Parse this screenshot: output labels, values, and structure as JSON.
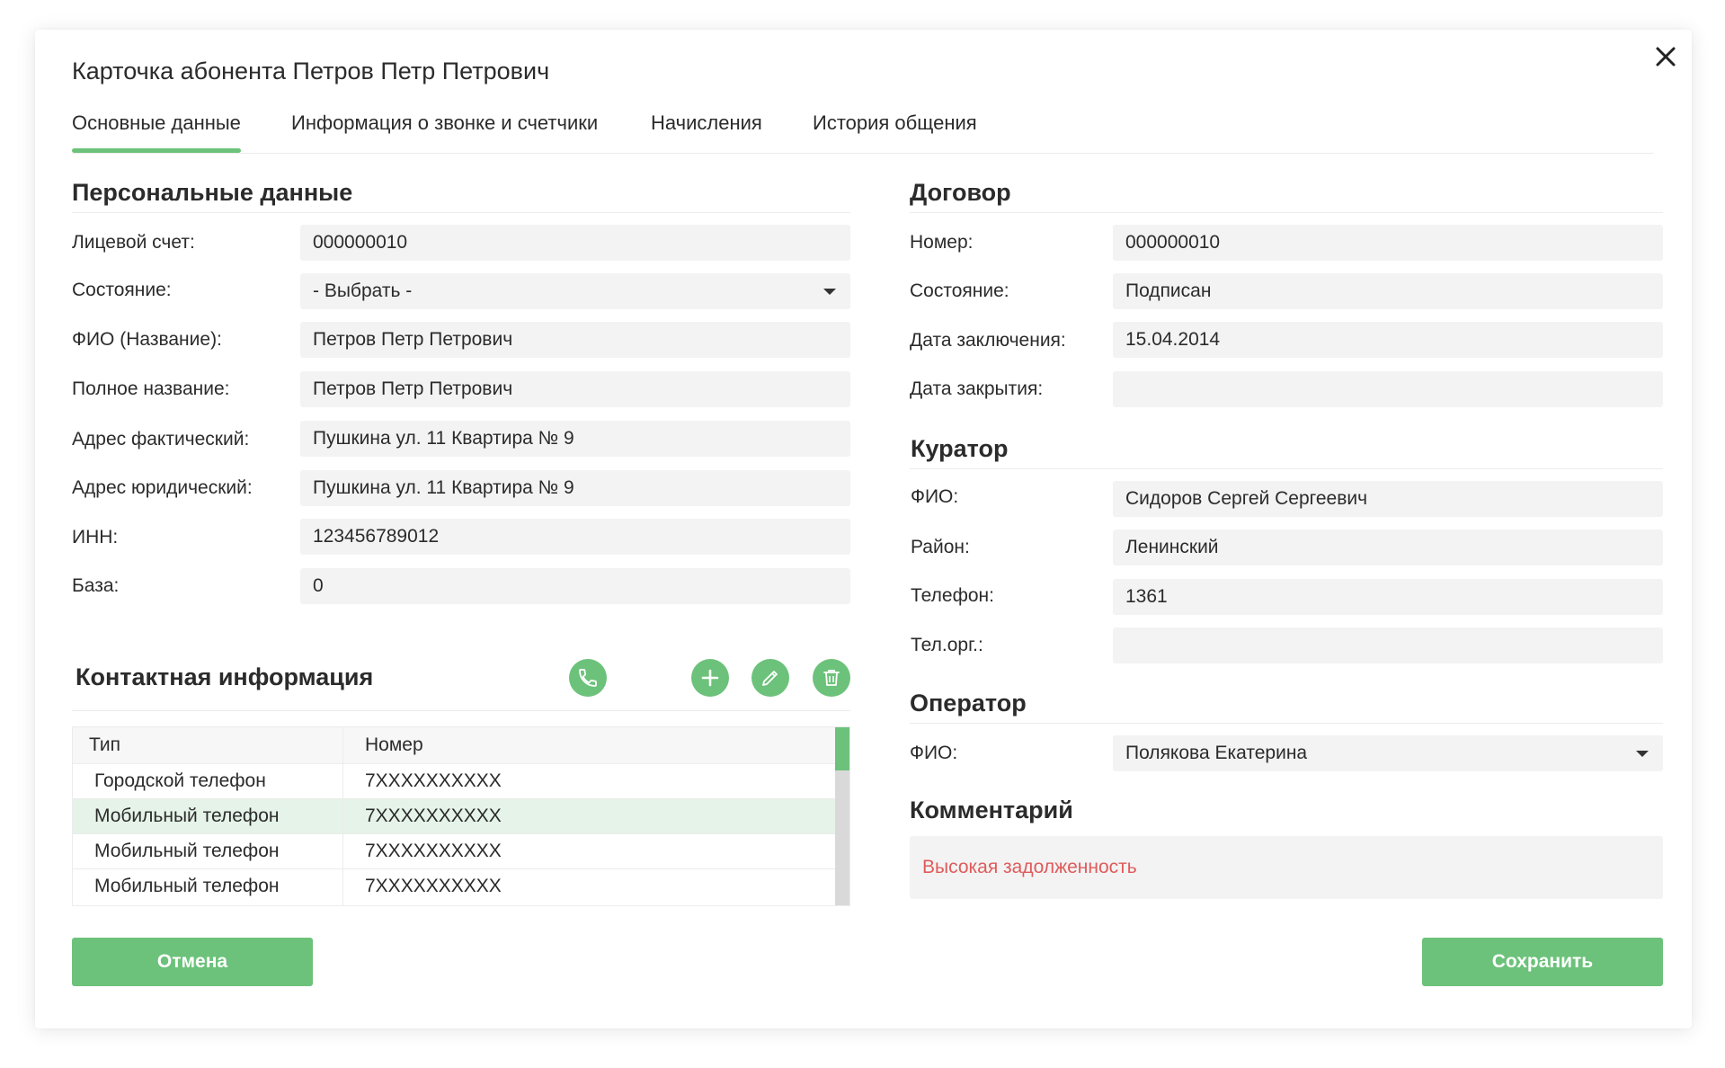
{
  "title": "Карточка абонента Петров Петр Петрович",
  "tabs": [
    {
      "label": "Основные данные",
      "active": true
    },
    {
      "label": "Информация о звонке и счетчики",
      "active": false
    },
    {
      "label": "Начисления",
      "active": false
    },
    {
      "label": "История общения",
      "active": false
    }
  ],
  "personal": {
    "heading": "Персональные данные",
    "fields": [
      {
        "label": "Лицевой счет:",
        "value": "000000010"
      },
      {
        "label": "Состояние:",
        "value": "- Выбрать -"
      },
      {
        "label": "ФИО (Название):",
        "value": "Петров Петр Петрович"
      },
      {
        "label": "Полное название:",
        "value": "Петров Петр Петрович"
      },
      {
        "label": "Адрес фактический:",
        "value": "Пушкина ул. 11 Квартира № 9"
      },
      {
        "label": "Адрес юридический:",
        "value": "Пушкина ул. 11 Квартира № 9"
      },
      {
        "label": "ИНН:",
        "value": "123456789012"
      },
      {
        "label": "База:",
        "value": "0"
      }
    ]
  },
  "contacts": {
    "heading": "Контактная информация",
    "columns": [
      "Тип",
      "Номер"
    ],
    "rows": [
      {
        "type": "Городской телефон",
        "number": "7XXXXXXXXXX"
      },
      {
        "type": "Мобильный телефон",
        "number": "7XXXXXXXXXX"
      },
      {
        "type": "Мобильный телефон",
        "number": "7XXXXXXXXXX"
      },
      {
        "type": "Мобильный телефон",
        "number": "7XXXXXXXXXX"
      }
    ],
    "selected_row": 1
  },
  "contract": {
    "heading": "Договор",
    "fields": [
      {
        "label": "Номер:",
        "value": "000000010"
      },
      {
        "label": "Состояние:",
        "value": "Подписан"
      },
      {
        "label": "Дата заключения:",
        "value": "15.04.2014"
      },
      {
        "label": "Дата закрытия:",
        "value": ""
      }
    ]
  },
  "curator": {
    "heading": "Куратор",
    "fields": [
      {
        "label": "ФИО:",
        "value": "Сидоров Сергей Сергеевич"
      },
      {
        "label": "Район:",
        "value": "Ленинский"
      },
      {
        "label": "Телефон:",
        "value": "1361"
      },
      {
        "label": "Тел.орг.:",
        "value": ""
      }
    ]
  },
  "operator": {
    "heading": "Оператор",
    "fields": [
      {
        "label": "ФИО:",
        "value": "Полякова Екатерина"
      }
    ]
  },
  "comment": {
    "heading": "Комментарий",
    "value": "Высокая задолженность",
    "color": "#e05b5b"
  },
  "buttons": {
    "cancel": "Отмена",
    "save": "Сохранить"
  },
  "icons": {
    "close": "close-icon",
    "call": "phone-icon",
    "add": "plus-icon",
    "edit": "pencil-icon",
    "delete": "trash-icon"
  },
  "colors": {
    "accent": "#6cc27a",
    "selected_row": "#e5f3e8",
    "field_bg": "#f3f3f3"
  }
}
